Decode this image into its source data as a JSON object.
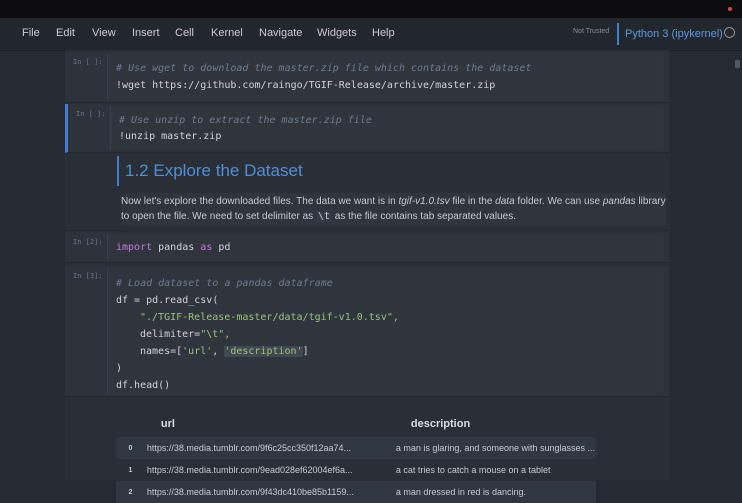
{
  "menu": {
    "items": [
      "File",
      "Edit",
      "View",
      "Insert",
      "Cell",
      "Kernel",
      "Navigate",
      "Widgets",
      "Help"
    ],
    "trust_status": "Not Trusted",
    "kernel_name": "Python 3 (ipykernel)"
  },
  "cells": {
    "c1": {
      "prompt": "In [ ]:",
      "comment": "# Use wget to download the master.zip file which contains the dataset",
      "code": "!wget https://github.com/raingo/TGIF-Release/archive/master.zip"
    },
    "c2": {
      "prompt": "In [ ]:",
      "comment": "# Use unzip to extract the master.zip file",
      "code": "!unzip master.zip"
    },
    "md": {
      "heading": "1.2  Explore the Dataset",
      "p1": "Now let's explore the downloaded files. The data we want is in ",
      "p1_file": "tgif-v1.0.tsv",
      "p2": " file in the ",
      "p2_folder": "data",
      "p3": " folder. We can use ",
      "p3_lib": "pandas",
      "p4": " library to open the file. We need to set delimiter as ",
      "p4_code": "\\t",
      "p5": " as the file contains tab separated values."
    },
    "c3": {
      "prompt": "In [2]:",
      "kw1": "import",
      "mod": " pandas ",
      "kw2": "as",
      "alias": " pd"
    },
    "c4": {
      "prompt": "In [3]:",
      "comment": "# Load dataset to a pandas dataframe",
      "l1": "df = pd.read_csv(",
      "l2": "\"./TGIF-Release-master/data/tgif-v1.0.tsv\",",
      "l3a": "delimiter=",
      "l3b": "\"\\t\",",
      "l4a": "names=[",
      "l4b": "'url'",
      "l4c": ", ",
      "l4d": "'description'",
      "l4e": "]",
      "l5": ")",
      "l6": "df.head()"
    }
  },
  "table": {
    "headers": [
      "",
      "url",
      "description"
    ],
    "rows": [
      [
        "0",
        "https://38.media.tumblr.com/9f6c25cc350f12aa74...",
        "a man is glaring, and someone with sunglasses ..."
      ],
      [
        "1",
        "https://38.media.tumblr.com/9ead028ef62004ef6a...",
        "a cat tries to catch a mouse on a tablet"
      ],
      [
        "2",
        "https://38.media.tumblr.com/9f43dc410be85b1159...",
        "a man dressed in red is dancing."
      ]
    ]
  }
}
